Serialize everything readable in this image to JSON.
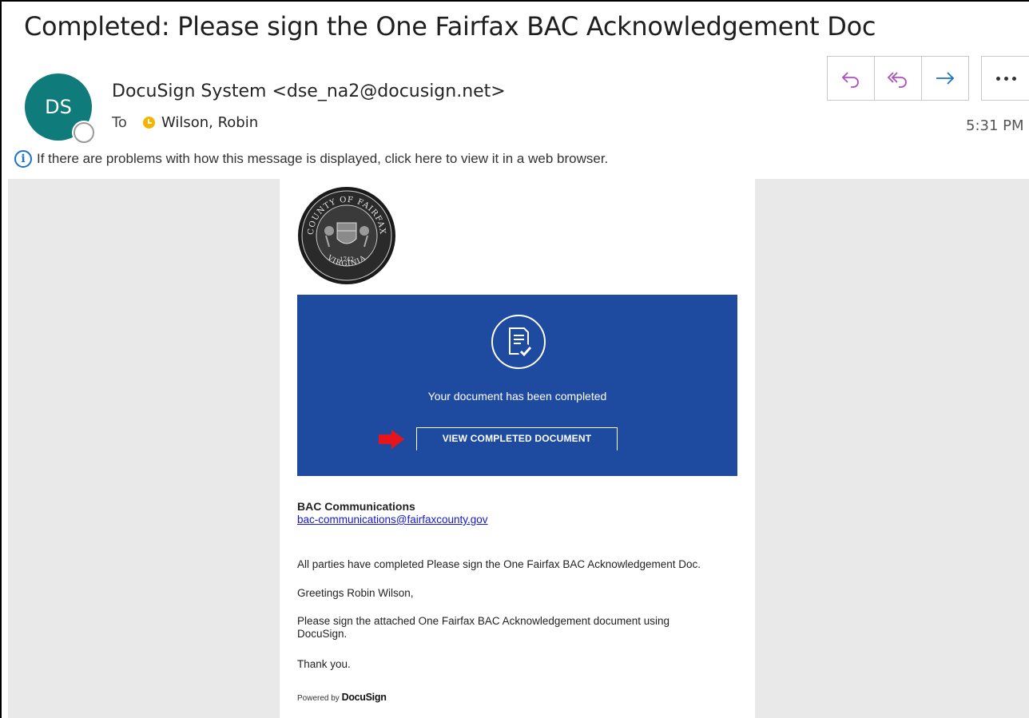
{
  "header": {
    "subject": "Completed: Please sign the One Fairfax BAC Acknowledgement Doc",
    "avatar_initials": "DS",
    "sender": "DocuSign System <dse_na2@docusign.net>",
    "to_label": "To",
    "to_name": "Wilson, Robin",
    "time": "5:31 PM",
    "actions": [
      "reply-icon",
      "reply-all-icon",
      "forward-icon",
      "more-icon"
    ]
  },
  "infobar": {
    "text": "If there are problems with how this message is displayed, click here to view it in a web browser."
  },
  "email": {
    "seal": {
      "top_text": "COUNTY OF FAIRFAX",
      "year": "1742",
      "bottom_text": "VIRGINIA"
    },
    "hero_text": "Your document has been completed",
    "button_label": "VIEW COMPLETED DOCUMENT",
    "org_name": "BAC Communications",
    "org_email": "bac-communications@fairfaxcounty.gov",
    "paragraphs": [
      "All parties have completed Please sign the One Fairfax BAC Acknowledgement Doc.",
      "Greetings Robin Wilson,",
      "Please sign the attached One Fairfax BAC Acknowledgement document using DocuSign.",
      "Thank you."
    ],
    "powered_by": "Powered by",
    "powered_brand": "DocuSign"
  },
  "colors": {
    "avatar": "#0f7b7b",
    "hero": "#1e4aa0",
    "action_icons": "#b04fc0",
    "forward_icon": "#1a73c6",
    "arrow": "#e8141b",
    "link": "#1515d8"
  }
}
